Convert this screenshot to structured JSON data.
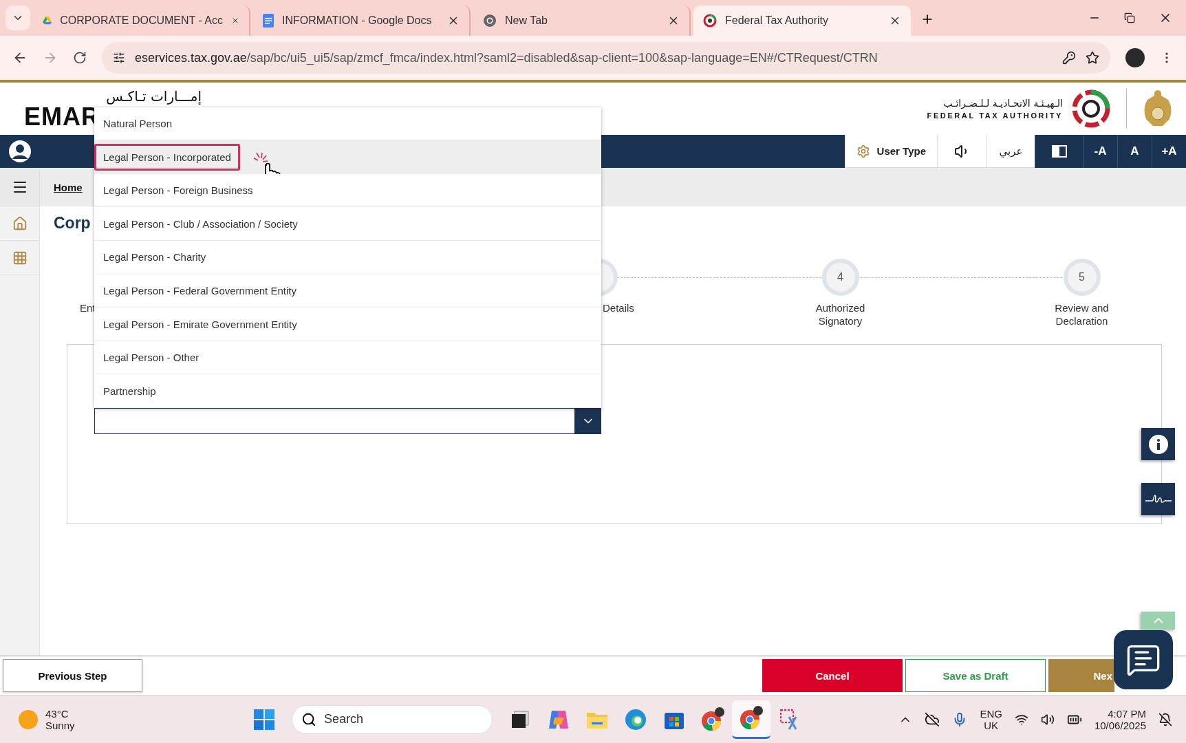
{
  "browser": {
    "tabs": [
      {
        "kind": "drive",
        "title": "CORPORATE DOCUMENT - Acc",
        "selected": false
      },
      {
        "kind": "docs",
        "title": "INFORMATION - Google Docs",
        "selected": false
      },
      {
        "kind": "chrome",
        "title": "New Tab",
        "selected": false
      },
      {
        "kind": "fta",
        "title": "Federal Tax Authority",
        "selected": true
      }
    ],
    "url_host": "eservices.tax.gov.ae",
    "url_path": "/sap/bc/ui5_ui5/sap/zmcf_fmca/index.html?saml2=disabled&sap-client=100&sap-language=EN#/CTRequest/CTRN"
  },
  "header": {
    "logo_arabic": "إمـــارات تـاكـس",
    "logo_latin": "EMAR",
    "authority_arabic": "الـهيـئـة الاتحـاديـة لـلـضـرائـب",
    "authority_english": "FEDERAL TAX AUTHORITY"
  },
  "toolbar": {
    "user_type": "User Type",
    "language": "عربي",
    "font_sizes": [
      "-A",
      "A",
      "+A"
    ]
  },
  "breadcrumb": {
    "home": "Home"
  },
  "page": {
    "title": "Corp",
    "steps": [
      {
        "kind": "label_only",
        "label": "Ent"
      },
      {
        "kind": "cut_circle",
        "label": "Details"
      },
      {
        "kind": "circle",
        "number": "4",
        "label": "Authorized Signatory"
      },
      {
        "kind": "circle",
        "number": "5",
        "label": "Review and Declaration"
      }
    ]
  },
  "dropdown": {
    "options": [
      {
        "label": "Natural Person",
        "selected": false,
        "annotated": false
      },
      {
        "label": "Legal Person - Incorporated",
        "selected": true,
        "annotated": true
      },
      {
        "label": "Legal Person - Foreign Business",
        "selected": false,
        "annotated": false
      },
      {
        "label": "Legal Person - Club / Association / Society",
        "selected": false,
        "annotated": false
      },
      {
        "label": "Legal Person - Charity",
        "selected": false,
        "annotated": false
      },
      {
        "label": "Legal Person - Federal Government Entity",
        "selected": false,
        "annotated": false
      },
      {
        "label": "Legal Person - Emirate Government Entity",
        "selected": false,
        "annotated": false
      },
      {
        "label": "Legal Person - Other",
        "selected": false,
        "annotated": false
      },
      {
        "label": "Partnership",
        "selected": false,
        "annotated": false
      }
    ]
  },
  "footer": {
    "previous": "Previous Step",
    "cancel": "Cancel",
    "save_draft": "Save as Draft",
    "next": "Nex"
  },
  "taskbar": {
    "temperature": "43°C",
    "weather": "Sunny",
    "search_placeholder": "Search",
    "language": "ENG",
    "region": "UK",
    "time": "4:07 PM",
    "date": "10/06/2025"
  }
}
